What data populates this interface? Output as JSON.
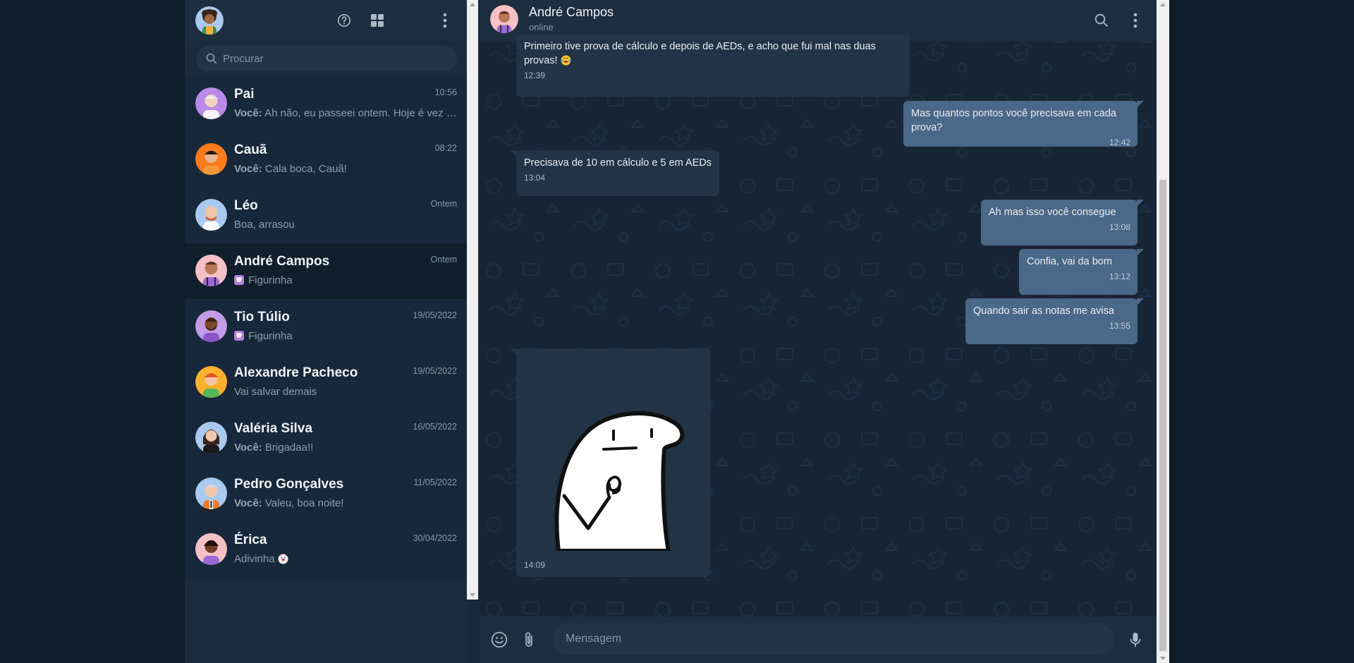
{
  "theme": {
    "app_bg": "#0f1d2b",
    "panel_bg": "#1b2b3c",
    "header_bg": "#1d2e40",
    "active_chat_bg": "#111f2d",
    "incoming_bubble": "#223446",
    "outgoing_bubble": "#4a6887",
    "muted_text": "#8899a6"
  },
  "sidebar": {
    "header_icons": [
      "help-icon",
      "grid-icon",
      "more-vert-icon"
    ],
    "search": {
      "placeholder": "Procurar",
      "icon": "search-icon"
    },
    "chats": [
      {
        "name": "Pai",
        "time": "10:56",
        "sender": "Você:",
        "preview": "Ah não, eu passeei ontem. Hoje é vez de ele",
        "avatar_color": "#b98ae6"
      },
      {
        "name": "Cauã",
        "time": "08:22",
        "sender": "Você:",
        "preview": "Cala boca, Cauã!",
        "avatar_color": "#ff7a1a"
      },
      {
        "name": "Léo",
        "time": "Ontem",
        "sender": "",
        "preview": "Boa, arrasou",
        "avatar_color": "#a9c9f0"
      },
      {
        "name": "André Campos",
        "time": "Ontem",
        "sender": "",
        "preview": "Figurinha",
        "sticker": true,
        "active": true,
        "avatar_color": "#f6c1c6"
      },
      {
        "name": "Tio Túlio",
        "time": "19/05/2022",
        "sender": "",
        "preview": "Figurinha",
        "sticker": true,
        "avatar_color": "#c39be6"
      },
      {
        "name": "Alexandre Pacheco",
        "time": "19/05/2022",
        "sender": "",
        "preview": "Vai salvar demais",
        "avatar_color": "#ffb02e"
      },
      {
        "name": "Valéria Silva",
        "time": "16/05/2022",
        "sender": "Você:",
        "preview": "Brigadaa!!",
        "avatar_color": "#a9c9f0"
      },
      {
        "name": "Pedro Gonçalves",
        "time": "11/05/2022",
        "sender": "Você:",
        "preview": "Valeu, boa noite!",
        "avatar_color": "#a9c9f0"
      },
      {
        "name": "Érica",
        "time": "30/04/2022",
        "sender": "",
        "preview": "Adivinha",
        "emoji": "clown-emoji",
        "avatar_color": "#f6c1c6"
      }
    ]
  },
  "chat": {
    "contact_name": "André Campos",
    "contact_status": "online",
    "header_icons": [
      "search-icon",
      "more-vert-icon"
    ],
    "messages": [
      {
        "dir": "in",
        "text": "Primeiro tive prova de cálculo e depois de AEDs, e acho que fui mal nas duas provas!",
        "emoji": "crying-laughing-emoji",
        "time": "12:39"
      },
      {
        "dir": "out",
        "text": "Mas quantos pontos você precisava em cada prova?",
        "time": "12:42"
      },
      {
        "dir": "in",
        "text": "Precisava de 10 em cálculo e 5 em AEDs",
        "time": "13:04"
      },
      {
        "dir": "out",
        "text": "Ah mas isso você consegue",
        "time": "13:08"
      },
      {
        "dir": "out",
        "text": "Confia, vai da bom",
        "time": "13:12"
      },
      {
        "dir": "out",
        "text": "Quando sair as notas me avisa",
        "time": "13:55"
      },
      {
        "dir": "in",
        "type": "sticker",
        "sticker": "flork-ok-sticker",
        "time": "14:09"
      }
    ],
    "composer": {
      "placeholder": "Mensagem",
      "icons": [
        "emoji-icon",
        "paperclip-icon",
        "microphone-icon"
      ]
    }
  }
}
